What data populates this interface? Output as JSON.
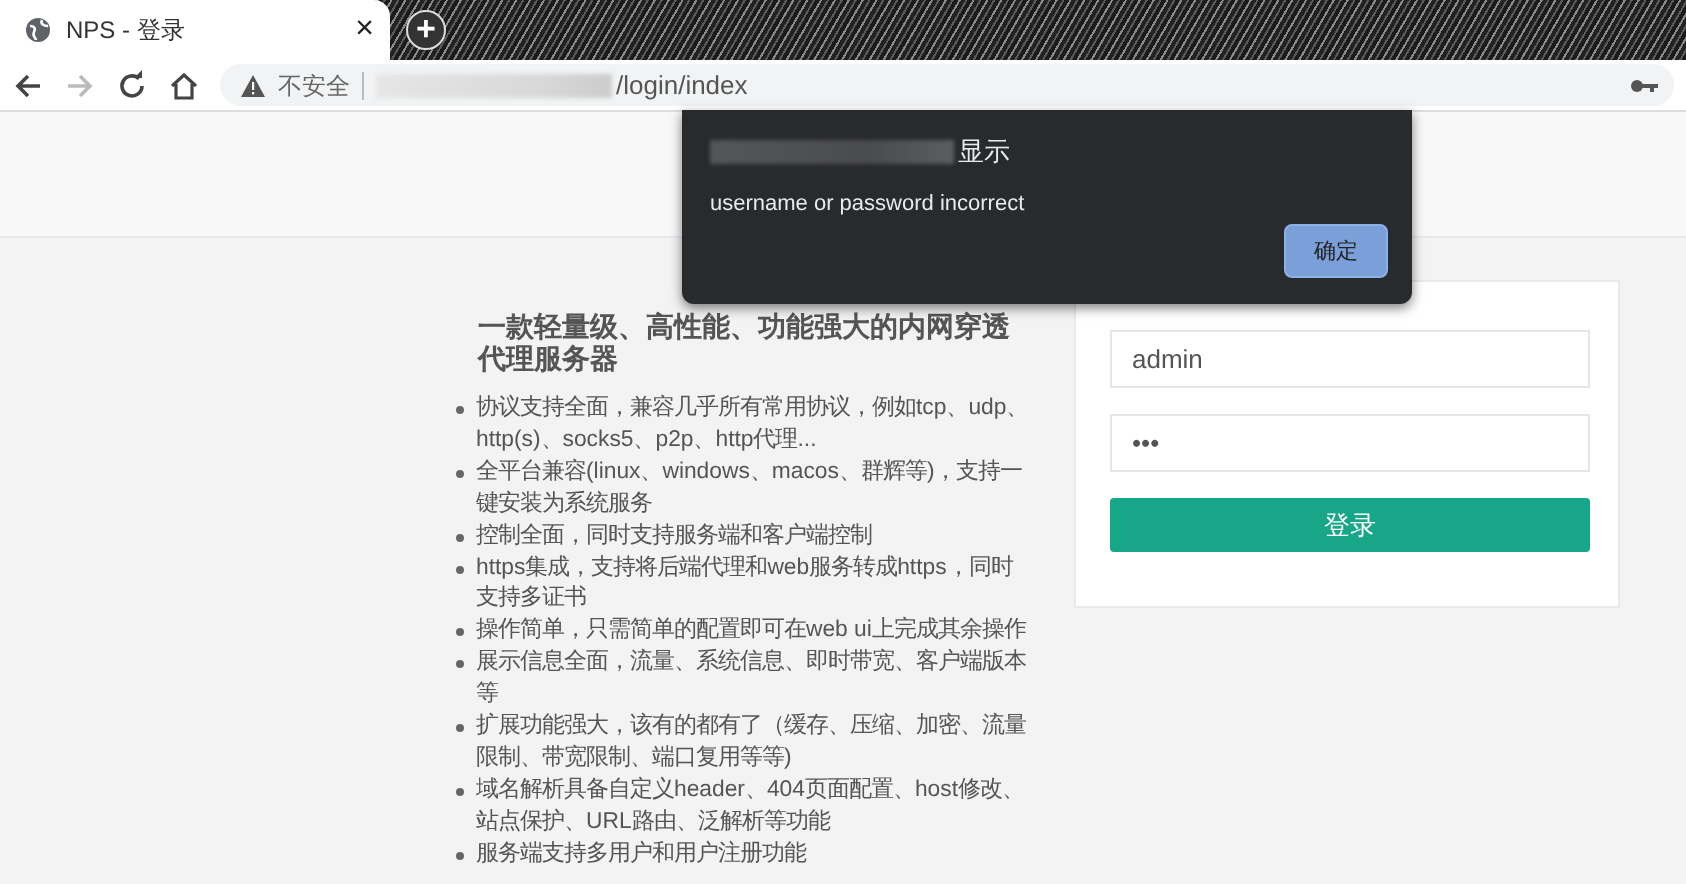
{
  "browser": {
    "tab": {
      "title": "NPS - 登录",
      "close": "×"
    },
    "new_tab": "+",
    "address": {
      "security": "不安全",
      "path": "/login/index"
    }
  },
  "page": {
    "heading": "一款轻量级、高性能、功能强大的内网穿透代理服务器",
    "features": [
      "协议支持全面，兼容几乎所有常用协议，例如tcp、udp、http(s)、socks5、p2p、http代理...",
      "全平台兼容(linux、windows、macos、群辉等)，支持一键安装为系统服务",
      "控制全面，同时支持服务端和客户端控制",
      "https集成，支持将后端代理和web服务转成https，同时支持多证书",
      "操作简单，只需简单的配置即可在web ui上完成其余操作",
      "展示信息全面，流量、系统信息、即时带宽、客户端版本等",
      "扩展功能强大，该有的都有了（缓存、压缩、加密、流量限制、带宽限制、端口复用等等)",
      "域名解析具备自定义header、404页面配置、host修改、站点保护、URL路由、泛解析等功能",
      "服务端支持多用户和用户注册功能"
    ],
    "login": {
      "username": "admin",
      "password": "•••",
      "submit": "登录"
    }
  },
  "dialog": {
    "title": "显示",
    "message": "username or password incorrect",
    "ok": "确定"
  }
}
